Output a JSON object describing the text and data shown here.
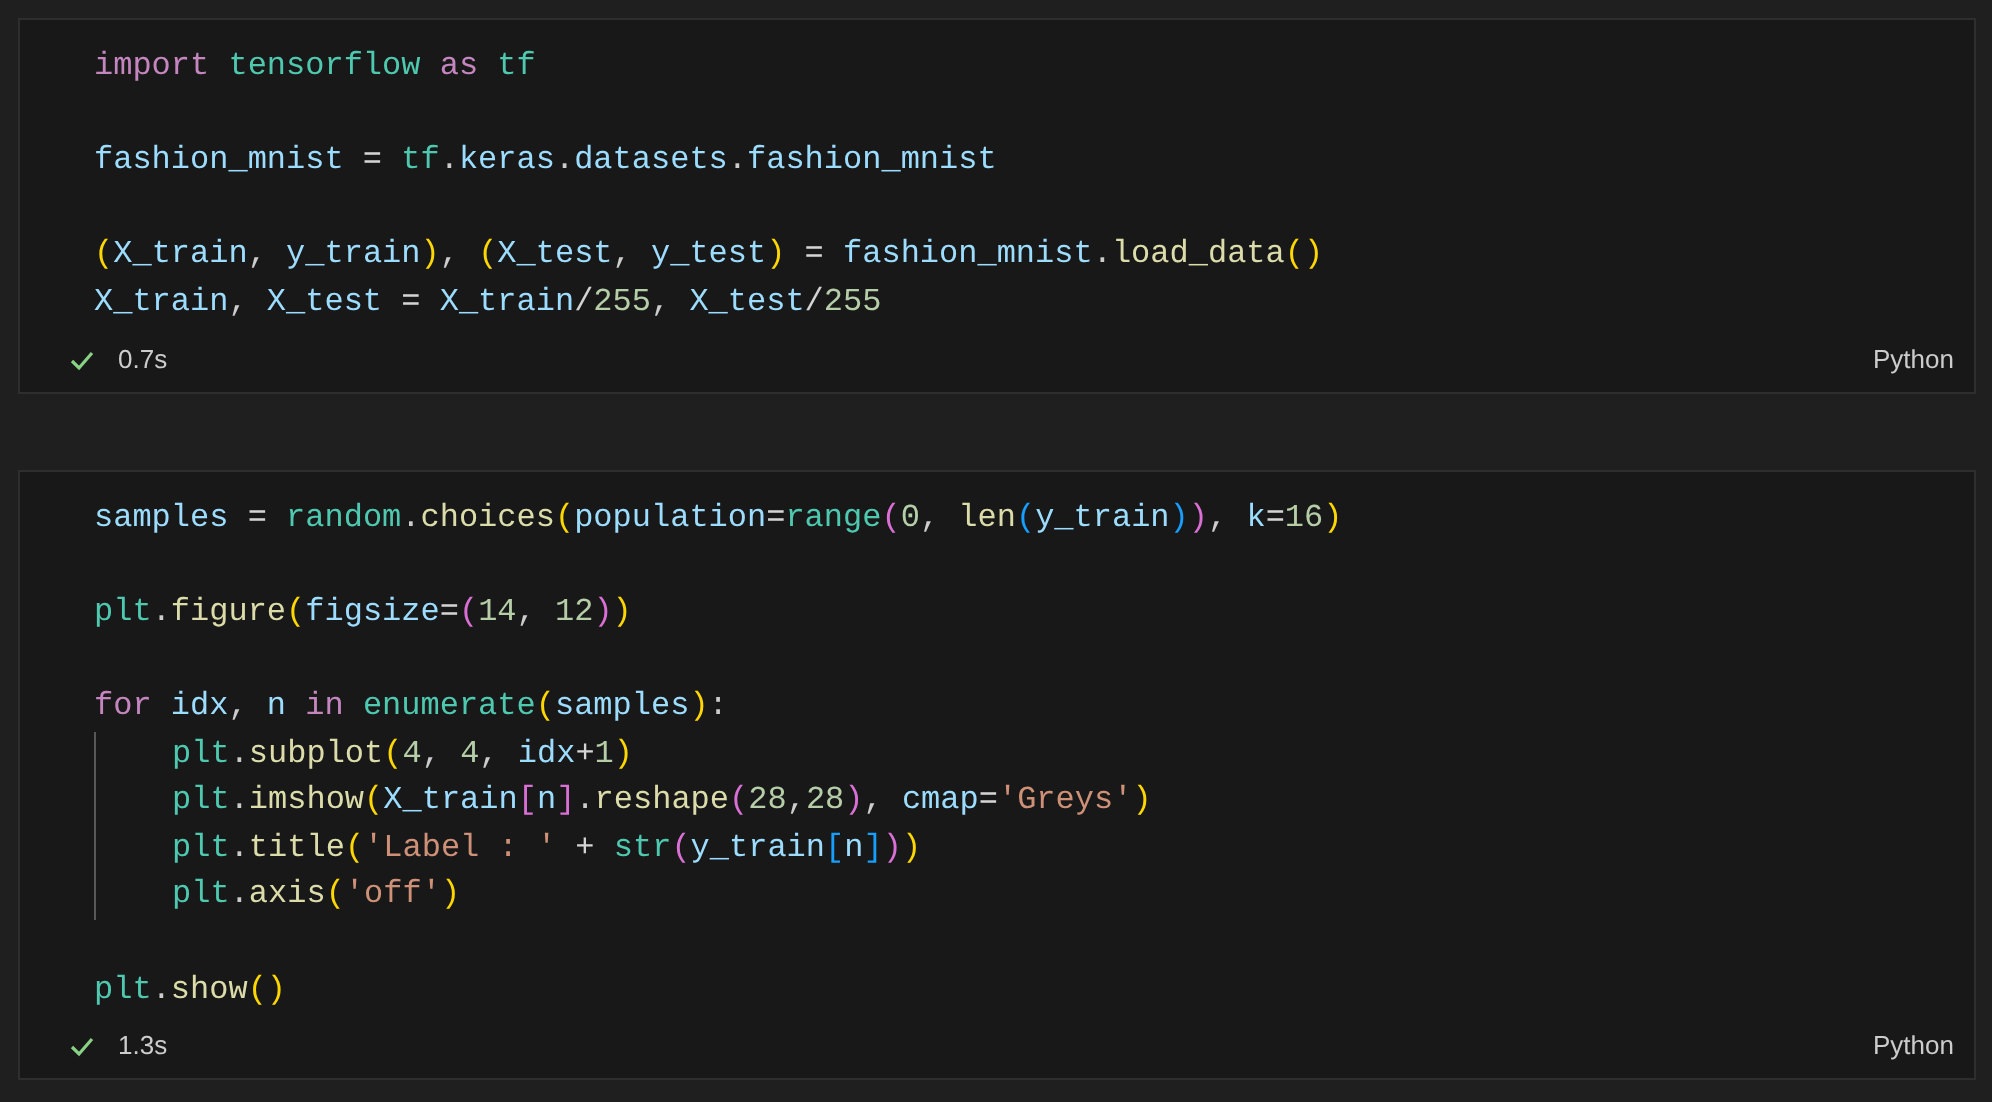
{
  "cells": [
    {
      "blocks": [
        [
          {
            "tokens": [
              {
                "text": "import ",
                "kind": "keyword"
              },
              {
                "text": "tensorflow ",
                "kind": "module"
              },
              {
                "text": "as ",
                "kind": "keyword"
              },
              {
                "text": "tf",
                "kind": "module"
              }
            ]
          }
        ],
        [
          {
            "tokens": [
              {
                "text": "fashion_mnist",
                "kind": "variable"
              },
              {
                "text": " = ",
                "kind": "operator"
              },
              {
                "text": "tf",
                "kind": "module"
              },
              {
                "text": ".",
                "kind": "plain"
              },
              {
                "text": "keras",
                "kind": "variable"
              },
              {
                "text": ".",
                "kind": "plain"
              },
              {
                "text": "datasets",
                "kind": "variable"
              },
              {
                "text": ".",
                "kind": "plain"
              },
              {
                "text": "fashion_mnist",
                "kind": "variable"
              }
            ]
          }
        ],
        [
          {
            "tokens": [
              {
                "text": "(",
                "kind": "bracket1"
              },
              {
                "text": "X_train",
                "kind": "variable"
              },
              {
                "text": ", ",
                "kind": "plain"
              },
              {
                "text": "y_train",
                "kind": "variable"
              },
              {
                "text": ")",
                "kind": "bracket1"
              },
              {
                "text": ", ",
                "kind": "plain"
              },
              {
                "text": "(",
                "kind": "bracket1"
              },
              {
                "text": "X_test",
                "kind": "variable"
              },
              {
                "text": ", ",
                "kind": "plain"
              },
              {
                "text": "y_test",
                "kind": "variable"
              },
              {
                "text": ")",
                "kind": "bracket1"
              },
              {
                "text": " = ",
                "kind": "operator"
              },
              {
                "text": "fashion_mnist",
                "kind": "variable"
              },
              {
                "text": ".",
                "kind": "plain"
              },
              {
                "text": "load_data",
                "kind": "function"
              },
              {
                "text": "()",
                "kind": "bracket1"
              }
            ]
          },
          {
            "tokens": [
              {
                "text": "X_train",
                "kind": "variable"
              },
              {
                "text": ", ",
                "kind": "plain"
              },
              {
                "text": "X_test",
                "kind": "variable"
              },
              {
                "text": " = ",
                "kind": "operator"
              },
              {
                "text": "X_train",
                "kind": "variable"
              },
              {
                "text": "/",
                "kind": "operator"
              },
              {
                "text": "255",
                "kind": "number"
              },
              {
                "text": ", ",
                "kind": "plain"
              },
              {
                "text": "X_test",
                "kind": "variable"
              },
              {
                "text": "/",
                "kind": "operator"
              },
              {
                "text": "255",
                "kind": "number"
              }
            ]
          }
        ]
      ],
      "succeeded": true,
      "duration": "0.7s",
      "language": "Python"
    },
    {
      "blocks": [
        [
          {
            "tokens": [
              {
                "text": "samples",
                "kind": "variable"
              },
              {
                "text": " = ",
                "kind": "operator"
              },
              {
                "text": "random",
                "kind": "module"
              },
              {
                "text": ".",
                "kind": "plain"
              },
              {
                "text": "choices",
                "kind": "function"
              },
              {
                "text": "(",
                "kind": "bracket1"
              },
              {
                "text": "population",
                "kind": "variable"
              },
              {
                "text": "=",
                "kind": "operator"
              },
              {
                "text": "range",
                "kind": "module"
              },
              {
                "text": "(",
                "kind": "bracket2"
              },
              {
                "text": "0",
                "kind": "number"
              },
              {
                "text": ", ",
                "kind": "plain"
              },
              {
                "text": "len",
                "kind": "function"
              },
              {
                "text": "(",
                "kind": "bracket3"
              },
              {
                "text": "y_train",
                "kind": "variable"
              },
              {
                "text": ")",
                "kind": "bracket3"
              },
              {
                "text": ")",
                "kind": "bracket2"
              },
              {
                "text": ", ",
                "kind": "plain"
              },
              {
                "text": "k",
                "kind": "variable"
              },
              {
                "text": "=",
                "kind": "operator"
              },
              {
                "text": "16",
                "kind": "number"
              },
              {
                "text": ")",
                "kind": "bracket1"
              }
            ]
          }
        ],
        [
          {
            "tokens": [
              {
                "text": "plt",
                "kind": "module"
              },
              {
                "text": ".",
                "kind": "plain"
              },
              {
                "text": "figure",
                "kind": "function"
              },
              {
                "text": "(",
                "kind": "bracket1"
              },
              {
                "text": "figsize",
                "kind": "variable"
              },
              {
                "text": "=",
                "kind": "operator"
              },
              {
                "text": "(",
                "kind": "bracket2"
              },
              {
                "text": "14",
                "kind": "number"
              },
              {
                "text": ", ",
                "kind": "plain"
              },
              {
                "text": "12",
                "kind": "number"
              },
              {
                "text": ")",
                "kind": "bracket2"
              },
              {
                "text": ")",
                "kind": "bracket1"
              }
            ]
          }
        ],
        [
          {
            "tokens": [
              {
                "text": "for ",
                "kind": "keyword"
              },
              {
                "text": "idx",
                "kind": "variable"
              },
              {
                "text": ", ",
                "kind": "plain"
              },
              {
                "text": "n ",
                "kind": "variable"
              },
              {
                "text": "in ",
                "kind": "keyword"
              },
              {
                "text": "enumerate",
                "kind": "module"
              },
              {
                "text": "(",
                "kind": "bracket1"
              },
              {
                "text": "samples",
                "kind": "variable"
              },
              {
                "text": ")",
                "kind": "bracket1"
              },
              {
                "text": ":",
                "kind": "plain"
              }
            ],
            "children": [
              {
                "tokens": [
                  {
                    "text": "plt",
                    "kind": "module"
                  },
                  {
                    "text": ".",
                    "kind": "plain"
                  },
                  {
                    "text": "subplot",
                    "kind": "function"
                  },
                  {
                    "text": "(",
                    "kind": "bracket1"
                  },
                  {
                    "text": "4",
                    "kind": "number"
                  },
                  {
                    "text": ", ",
                    "kind": "plain"
                  },
                  {
                    "text": "4",
                    "kind": "number"
                  },
                  {
                    "text": ", ",
                    "kind": "plain"
                  },
                  {
                    "text": "idx",
                    "kind": "variable"
                  },
                  {
                    "text": "+",
                    "kind": "operator"
                  },
                  {
                    "text": "1",
                    "kind": "number"
                  },
                  {
                    "text": ")",
                    "kind": "bracket1"
                  }
                ]
              },
              {
                "tokens": [
                  {
                    "text": "plt",
                    "kind": "module"
                  },
                  {
                    "text": ".",
                    "kind": "plain"
                  },
                  {
                    "text": "imshow",
                    "kind": "function"
                  },
                  {
                    "text": "(",
                    "kind": "bracket1"
                  },
                  {
                    "text": "X_train",
                    "kind": "variable"
                  },
                  {
                    "text": "[",
                    "kind": "bracket2"
                  },
                  {
                    "text": "n",
                    "kind": "variable"
                  },
                  {
                    "text": "]",
                    "kind": "bracket2"
                  },
                  {
                    "text": ".",
                    "kind": "plain"
                  },
                  {
                    "text": "reshape",
                    "kind": "function"
                  },
                  {
                    "text": "(",
                    "kind": "bracket2"
                  },
                  {
                    "text": "28",
                    "kind": "number"
                  },
                  {
                    "text": ",",
                    "kind": "plain"
                  },
                  {
                    "text": "28",
                    "kind": "number"
                  },
                  {
                    "text": ")",
                    "kind": "bracket2"
                  },
                  {
                    "text": ", ",
                    "kind": "plain"
                  },
                  {
                    "text": "cmap",
                    "kind": "variable"
                  },
                  {
                    "text": "=",
                    "kind": "operator"
                  },
                  {
                    "text": "'Greys'",
                    "kind": "string"
                  },
                  {
                    "text": ")",
                    "kind": "bracket1"
                  }
                ]
              },
              {
                "tokens": [
                  {
                    "text": "plt",
                    "kind": "module"
                  },
                  {
                    "text": ".",
                    "kind": "plain"
                  },
                  {
                    "text": "title",
                    "kind": "function"
                  },
                  {
                    "text": "(",
                    "kind": "bracket1"
                  },
                  {
                    "text": "'Label : '",
                    "kind": "string"
                  },
                  {
                    "text": " + ",
                    "kind": "operator"
                  },
                  {
                    "text": "str",
                    "kind": "module"
                  },
                  {
                    "text": "(",
                    "kind": "bracket2"
                  },
                  {
                    "text": "y_train",
                    "kind": "variable"
                  },
                  {
                    "text": "[",
                    "kind": "bracket3"
                  },
                  {
                    "text": "n",
                    "kind": "variable"
                  },
                  {
                    "text": "]",
                    "kind": "bracket3"
                  },
                  {
                    "text": ")",
                    "kind": "bracket2"
                  },
                  {
                    "text": ")",
                    "kind": "bracket1"
                  }
                ]
              },
              {
                "tokens": [
                  {
                    "text": "plt",
                    "kind": "module"
                  },
                  {
                    "text": ".",
                    "kind": "plain"
                  },
                  {
                    "text": "axis",
                    "kind": "function"
                  },
                  {
                    "text": "(",
                    "kind": "bracket1"
                  },
                  {
                    "text": "'off'",
                    "kind": "string"
                  },
                  {
                    "text": ")",
                    "kind": "bracket1"
                  }
                ]
              }
            ]
          }
        ],
        [
          {
            "tokens": [
              {
                "text": "plt",
                "kind": "module"
              },
              {
                "text": ".",
                "kind": "plain"
              },
              {
                "text": "show",
                "kind": "function"
              },
              {
                "text": "()",
                "kind": "bracket1"
              }
            ]
          }
        ]
      ],
      "succeeded": true,
      "duration": "1.3s",
      "language": "Python"
    }
  ]
}
